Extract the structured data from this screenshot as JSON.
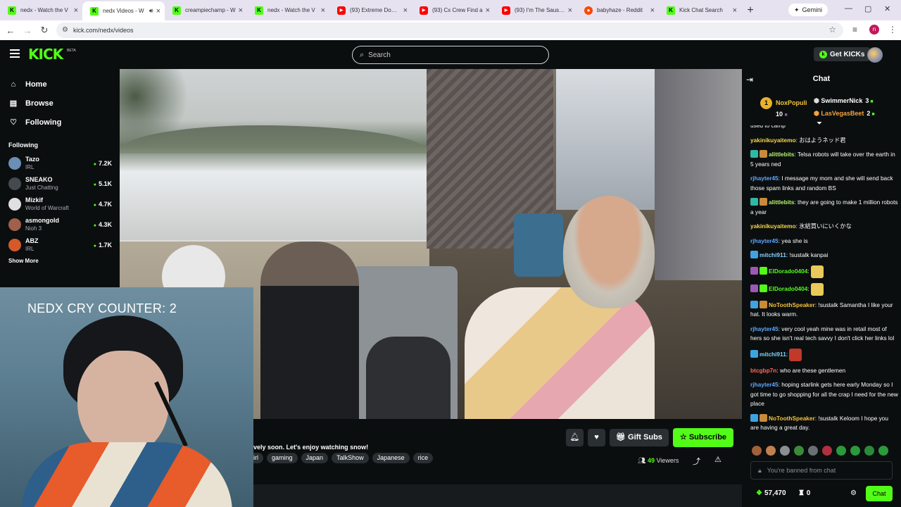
{
  "browser": {
    "tabs": [
      {
        "title": "nedx - Watch the V",
        "fav": "kick",
        "active": false
      },
      {
        "title": "nedx Videos - W",
        "fav": "kick",
        "active": true,
        "audio": true
      },
      {
        "title": "creampiechamp - W",
        "fav": "kick",
        "active": false
      },
      {
        "title": "nedx - Watch the V",
        "fav": "kick",
        "active": false
      },
      {
        "title": "(93) Extreme Downh",
        "fav": "yt",
        "active": false
      },
      {
        "title": "(93) Cx Crew Find a",
        "fav": "yt",
        "active": false
      },
      {
        "title": "(93) I'm The Sausag",
        "fav": "yt",
        "active": false
      },
      {
        "title": "babyhaze - Reddit",
        "fav": "reddit",
        "active": false
      },
      {
        "title": "Kick Chat Search",
        "fav": "kick",
        "active": false
      }
    ],
    "gemini_label": "Gemini",
    "url": "kick.com/nedx/videos",
    "profile_initial": "n"
  },
  "header": {
    "logo": "KICK",
    "beta": "BETA",
    "search_placeholder": "Search",
    "get_kicks": "Get KICKs"
  },
  "sidebar": {
    "nav": [
      {
        "label": "Home",
        "icon": "home-icon"
      },
      {
        "label": "Browse",
        "icon": "browse-icon"
      },
      {
        "label": "Following",
        "icon": "heart-icon"
      }
    ],
    "following_heading": "Following",
    "channels": [
      {
        "name": "Tazo",
        "category": "IRL",
        "viewers": "7.2K",
        "color": "#6b8fb5"
      },
      {
        "name": "SNEAKO",
        "category": "Just Chatting",
        "viewers": "5.1K",
        "color": "#444a50"
      },
      {
        "name": "Mizkif",
        "category": "World of Warcraft",
        "viewers": "4.7K",
        "color": "#e0e0e0"
      },
      {
        "name": "asmongold",
        "category": "Nioh 3",
        "viewers": "4.3K",
        "color": "#a0604a"
      },
      {
        "name": "ABZ",
        "category": "IRL",
        "viewers": "1.7K",
        "color": "#d45a2a"
      }
    ],
    "show_more": "Show More"
  },
  "webcam": {
    "counter_text": "NEDX CRY COUNTER: 2"
  },
  "stream": {
    "title_fragment": "vely soon. Let's enjoy watching snow!",
    "tags": [
      "irl",
      "gaming",
      "Japan",
      "TalkShow",
      "Japanese",
      "rice"
    ],
    "gift_subs": "Gift Subs",
    "subscribe": "Subscribe",
    "viewer_count": "49",
    "viewers_label": "Viewers"
  },
  "chat": {
    "title": "Chat",
    "leaderboard": {
      "first": {
        "rank": "1",
        "name": "NoxPopuli",
        "points": "10"
      },
      "others": [
        {
          "name": "SwimmerNick",
          "points": "3",
          "color": "#ffffff"
        },
        {
          "name": "LasVegasBeet",
          "points": "2",
          "color": "#f4a43c"
        }
      ]
    },
    "messages": [
      {
        "user": "",
        "color": "#ffffff",
        "text": "used to camp",
        "badges": []
      },
      {
        "user": "yakinikuyaitemo",
        "color": "#f6d64a",
        "text": "おはようネッド君",
        "badges": []
      },
      {
        "user": "alittlebits",
        "color": "#b3f26a",
        "text": "Telsa robots will take over the earth in 5 years ned",
        "badges": [
          "#2fb8a5",
          "#c98a3a"
        ]
      },
      {
        "user": "rjhayter45",
        "color": "#5ea8ff",
        "text": "I message my mom and she will send back those spam links and random BS",
        "badges": []
      },
      {
        "user": "alittlebits",
        "color": "#b3f26a",
        "text": "they are going to make 1 million robots a year",
        "badges": [
          "#2fb8a5",
          "#c98a3a"
        ]
      },
      {
        "user": "yakinikuyaitemo",
        "color": "#f6d64a",
        "text": "氷結買いにいくかな",
        "badges": []
      },
      {
        "user": "rjhayter45",
        "color": "#5ea8ff",
        "text": "yea she is",
        "badges": []
      },
      {
        "user": "mitchi911",
        "color": "#7fd4ff",
        "text": "!sustalk kanpai",
        "badges": [
          "#3fa3e0"
        ]
      },
      {
        "user": "ElDorado0404",
        "color": "#53fc18",
        "text": "",
        "badges": [
          "#9b59b6",
          "#53fc18"
        ],
        "emote": "#e8c95a"
      },
      {
        "user": "ElDorado0404",
        "color": "#53fc18",
        "text": "",
        "badges": [
          "#9b59b6",
          "#53fc18"
        ],
        "emote": "#e8c95a"
      },
      {
        "user": "NoToothSpeaker",
        "color": "#f4c13a",
        "text": "!sustalk Samantha I like your hat. It looks warm.",
        "badges": [
          "#3fa3e0",
          "#c98a3a"
        ]
      },
      {
        "user": "rjhayter45",
        "color": "#5ea8ff",
        "text": "very cool yeah mine was in retail most of hers so she isn't real tech savvy I don't click her links lol",
        "badges": []
      },
      {
        "user": "mitchi911",
        "color": "#7fd4ff",
        "text": "",
        "badges": [
          "#3fa3e0"
        ],
        "emote": "#c0392b"
      },
      {
        "user": "btcgbp7n",
        "color": "#ff6b5a",
        "text": "who are these gentlemen",
        "badges": []
      },
      {
        "user": "rjhayter45",
        "color": "#5ea8ff",
        "text": "hoping starlink gets here early Monday so I got time to go shopping for all the crap I need for the new place",
        "badges": []
      },
      {
        "user": "NoToothSpeaker",
        "color": "#f4c13a",
        "text": "!sustalk Keloom I hope you are having a great day.",
        "badges": [
          "#3fa3e0",
          "#c98a3a"
        ]
      }
    ],
    "banned_text": "You're banned from chat",
    "kicks_balance": "57,470",
    "subs_count": "0",
    "chat_button": "Chat"
  }
}
